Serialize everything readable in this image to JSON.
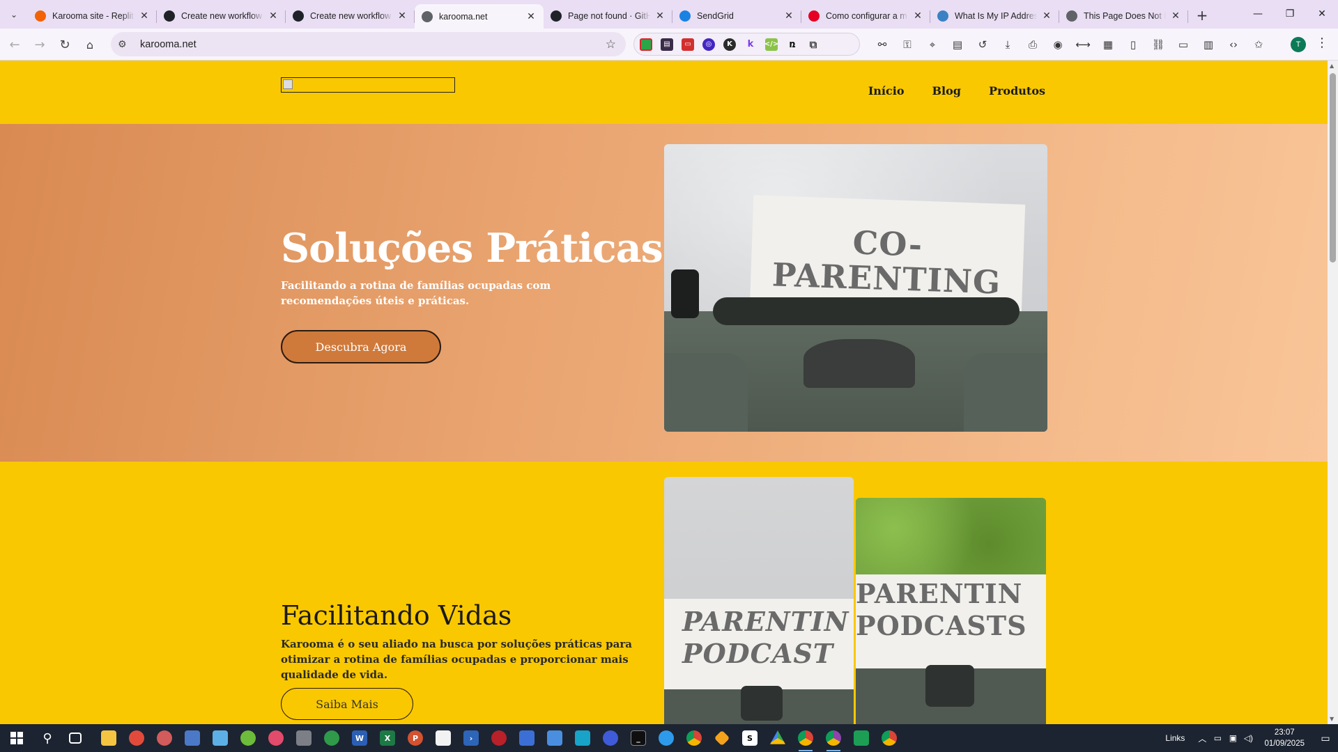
{
  "browser": {
    "tabs": [
      {
        "title": "Karooma site - Replit",
        "favicon": "replit-icon",
        "color": "#f26207",
        "active": false
      },
      {
        "title": "Create new workflow",
        "favicon": "github-icon",
        "color": "#1f2328",
        "active": false
      },
      {
        "title": "Create new workflow",
        "favicon": "github-icon",
        "color": "#1f2328",
        "active": false
      },
      {
        "title": "karooma.net",
        "favicon": "globe-icon",
        "color": "#5f6368",
        "active": true
      },
      {
        "title": "Page not found · GitHub",
        "favicon": "github-icon",
        "color": "#1f2328",
        "active": false
      },
      {
        "title": "SendGrid",
        "favicon": "sendgrid-icon",
        "color": "#1a82e2",
        "active": false
      },
      {
        "title": "Como configurar a m",
        "favicon": "pinterest-icon",
        "color": "#e60023",
        "active": false
      },
      {
        "title": "What Is My IP Address",
        "favicon": "globe-color-icon",
        "color": "#3b82c4",
        "active": false
      },
      {
        "title": "This Page Does Not E",
        "favicon": "globe-icon",
        "color": "#5f6368",
        "active": false
      }
    ],
    "url": "karooma.net",
    "profile_initial": "T"
  },
  "site": {
    "nav": [
      {
        "label": "Início"
      },
      {
        "label": "Blog"
      },
      {
        "label": "Produtos"
      }
    ],
    "hero": {
      "title": "Soluções Práticas",
      "subtitle": "Facilitando a rotina de famílias ocupadas com recomendações úteis e práticas.",
      "cta": "Descubra Agora",
      "image_text_line1": "CO-",
      "image_text_line2": "PARENTING"
    },
    "about": {
      "title": "Facilitando Vidas",
      "text": "Karooma é o seu aliado na busca por soluções práticas para otimizar a rotina de famílias ocupadas e proporcionar mais qualidade de vida.",
      "cta": "Saiba Mais",
      "image1_line1": "PARENTIN",
      "image1_line2": "PODCAST",
      "image2_line1": "PARENTIN",
      "image2_line2": "PODCASTS"
    },
    "colors": {
      "yellow": "#f9c800",
      "hero_orange": "#e9a470",
      "button_orange": "#cf7a3b"
    }
  },
  "taskbar": {
    "tray_links_label": "Links",
    "time": "23:07",
    "date": "01/09/2025"
  }
}
